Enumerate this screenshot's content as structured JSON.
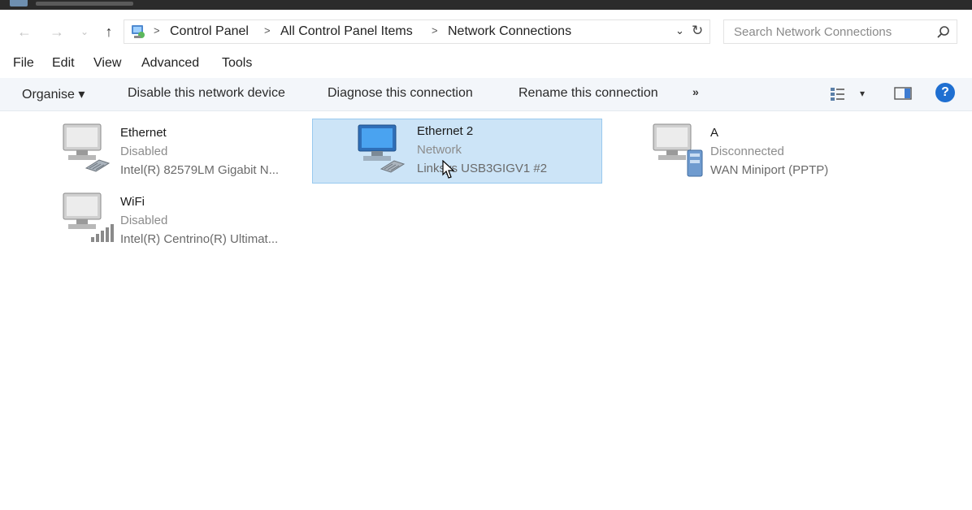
{
  "address": {
    "crumbs": [
      "Control Panel",
      "All Control Panel Items",
      "Network Connections"
    ],
    "separator": ">",
    "dropdown_glyph": "⌄",
    "refresh_glyph": "↻"
  },
  "nav": {
    "back_glyph": "←",
    "forward_glyph": "→",
    "recent_glyph": "⌄",
    "up_glyph": "↑"
  },
  "search": {
    "placeholder": "Search Network Connections"
  },
  "menu": [
    "File",
    "Edit",
    "View",
    "Advanced",
    "Tools"
  ],
  "commands": {
    "organise": "Organise ▾",
    "disable": "Disable this network device",
    "diagnose": "Diagnose this connection",
    "rename": "Rename this connection",
    "more": "»",
    "view_dropdown": "▾",
    "help": "?"
  },
  "connections": [
    {
      "name": "Ethernet",
      "status": "Disabled",
      "device": "Intel(R) 82579LM Gigabit N...",
      "selected": false,
      "icon": "ethernet-icon"
    },
    {
      "name": "Ethernet 2",
      "status": "Network",
      "device": "Linksys USB3GIGV1 #2",
      "selected": true,
      "icon": "ethernet-icon"
    },
    {
      "name": "A",
      "status": "Disconnected",
      "device": "WAN Miniport (PPTP)",
      "selected": false,
      "icon": "vpn-icon"
    },
    {
      "name": "WiFi",
      "status": "Disabled",
      "device": "Intel(R) Centrino(R) Ultimat...",
      "selected": false,
      "icon": "wifi-icon"
    }
  ],
  "colors": {
    "selection": "#cce4f7",
    "selection_border": "#99c9ef",
    "help": "#1f6fd1",
    "command_bar": "#f3f6fa"
  }
}
